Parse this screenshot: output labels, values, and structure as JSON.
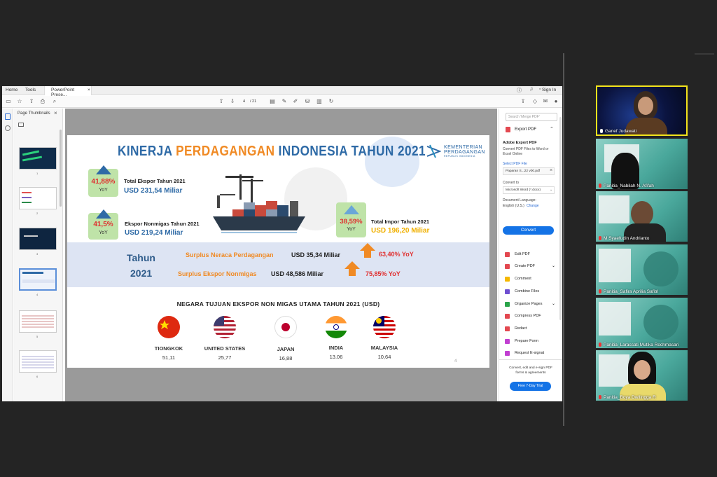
{
  "app": {
    "menu": {
      "home": "Home",
      "tools": "Tools",
      "sign_in": "Sign In"
    },
    "tab": {
      "title": "PowerPoint Prese...",
      "close": "×"
    },
    "page_current": "4",
    "page_total": "/ 21"
  },
  "thumbnails": {
    "title": "Page Thumbnails",
    "pages": [
      "1",
      "2",
      "3",
      "4",
      "5",
      "6"
    ]
  },
  "slide": {
    "title_a": "KINERJA ",
    "title_b": "PERDAGANGAN ",
    "title_c": "INDONESIA ",
    "title_d": "TAHUN 2021",
    "logo_line1": "KEMENTERIAN",
    "logo_line2": "PERDAGANGAN",
    "logo_line3": "REPUBLIK INDONESIA",
    "kpi1": {
      "pct": "41,88%",
      "yoy": "YoY",
      "label": "Total Ekspor Tahun 2021",
      "value": "USD 231,54 Miliar"
    },
    "kpi2": {
      "pct": "41,5%",
      "yoy": "YoY",
      "label": "Ekspor Nonmigas Tahun 2021",
      "value": "USD 219,24 Miliar"
    },
    "kpi3": {
      "pct": "38,59%",
      "yoy": "YoY",
      "label": "Total Impor Tahun 2021",
      "value": "USD 196,20 Miliar"
    },
    "band": {
      "year_a": "Tahun",
      "year_b": "2021",
      "row1_label": "Surplus Neraca Perdagangan",
      "row1_value": "USD 35,34 Miliar",
      "row1_growth": "63,40% YoY",
      "row2_label": "Surplus Ekspor Nonmigas",
      "row2_value": "USD 48,586 Miliar",
      "row2_growth": "75,85% YoY"
    },
    "dest_title": "NEGARA TUJUAN EKSPOR NON MIGAS UTAMA TAHUN 2021 (USD)",
    "countries": [
      {
        "name": "TIONGKOK",
        "value": "51,11"
      },
      {
        "name": "UNITED STATES",
        "value": "25,77"
      },
      {
        "name": "JAPAN",
        "value": "16,88"
      },
      {
        "name": "INDIA",
        "value": "13.06"
      },
      {
        "name": "MALAYSIA",
        "value": "10,64"
      }
    ],
    "page_no": "4"
  },
  "right_panel": {
    "search_placeholder": "Search 'Merge PDF'",
    "export_title": "Export PDF",
    "adobe_title": "Adobe Export PDF",
    "adobe_desc": "Convert PDF Files to Word or Excel Online",
    "select_label": "Select PDF File",
    "file_name": "Paparan S...22 v00.pdf",
    "convert_to": "Convert to",
    "format": "Microsoft Word (*.docx)",
    "doc_lang": "Document Language:",
    "lang": "English (U.S.)",
    "change": "Change",
    "convert_btn": "Convert",
    "tools": [
      "Edit PDF",
      "Create PDF",
      "Comment",
      "Combine Files",
      "Organize Pages",
      "Compress PDF",
      "Redact",
      "Prepare Form",
      "Request E-signat"
    ],
    "promo": "Convert, edit and e-sign PDF forms & agreements",
    "trial_btn": "Free 7-Day Trial"
  },
  "participants": [
    "Ganef Judawati",
    "Panitia_Nabilah N. Afifah",
    "M Syaefudin Andrianto",
    "Panitia_Safira Aprilia Safitri",
    "Panitia_Larassati Mutika Rochmasari",
    "Panitia_Boya Dwilingga R"
  ],
  "colors": {
    "title_blue": "#2e6aa6",
    "accent_orange": "#f08a24",
    "kpi_green": "#bfe3a8",
    "band_bg": "#dde4f3",
    "active_speaker": "#f2e31c"
  }
}
